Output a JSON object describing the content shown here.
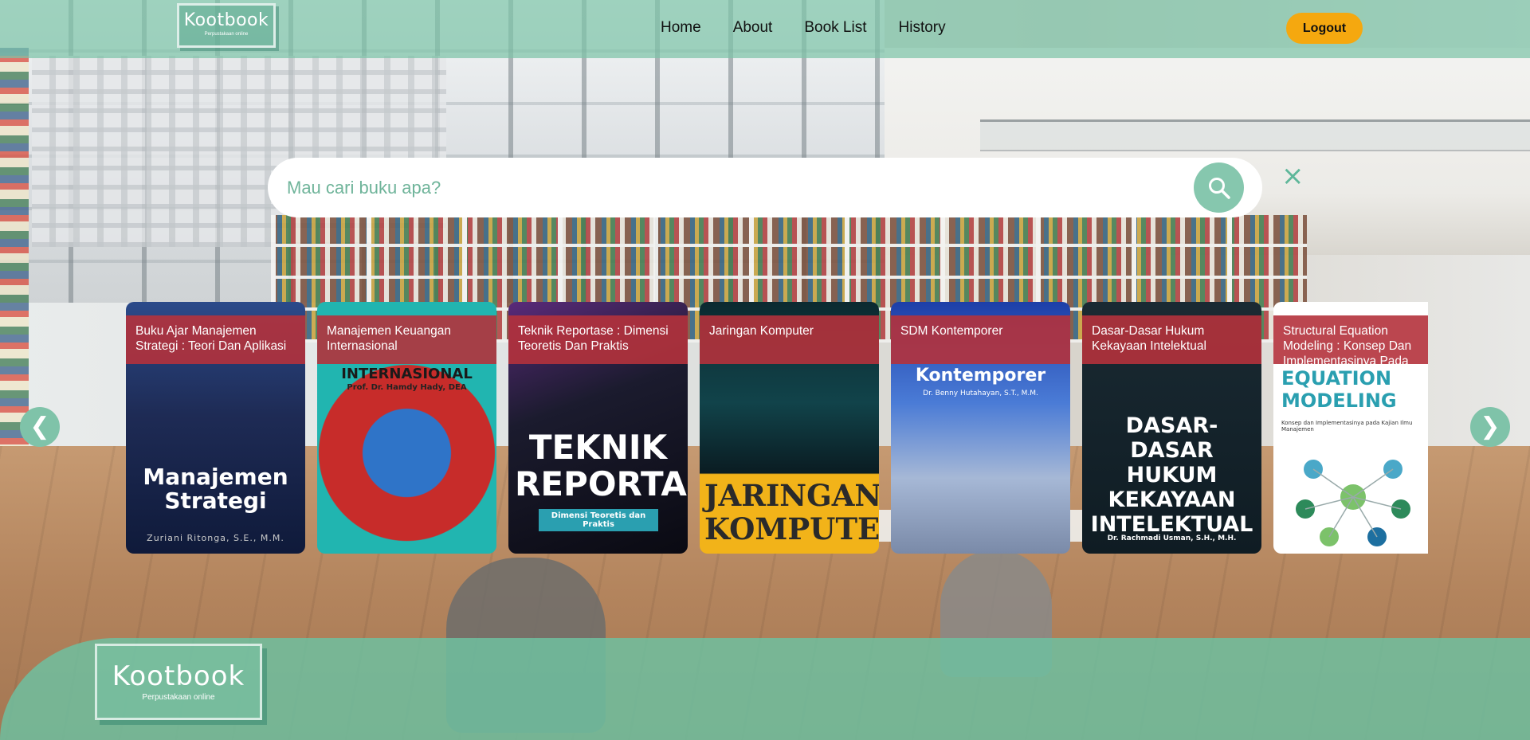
{
  "nav": {
    "logo_text": "Kootbook",
    "logo_sub": "Perpustakaan online",
    "links": [
      "Home",
      "About",
      "Book List",
      "History"
    ],
    "logout_label": "Logout"
  },
  "search": {
    "placeholder": "Mau cari buku apa?",
    "clear_icon": "×"
  },
  "carousel": {
    "prev_icon": "❮",
    "next_icon": "❯",
    "books": [
      {
        "title": "Buku Ajar Manajemen Strategi : Teori Dan Aplikasi",
        "cover_text": "Manajemen Strategi",
        "cover_sub": "Zuriani Ritonga, S.E., M.M."
      },
      {
        "title": "Manajemen Keuangan Internasional",
        "cover_text": "INTERNASIONAL",
        "cover_sub": "Prof. Dr. Hamdy Hady, DEA"
      },
      {
        "title": "Teknik Reportase : Dimensi Teoretis Dan Praktis",
        "cover_text": "TEKNIK REPORTASE",
        "cover_sub": "Dimensi Teoretis dan Praktis"
      },
      {
        "title": "Jaringan Komputer",
        "cover_text": "JARINGAN KOMPUTER",
        "cover_sub": ""
      },
      {
        "title": "SDM Kontemporer",
        "cover_text": "Kontemporer",
        "cover_sub": "Dr. Benny Hutahayan, S.T., M.M."
      },
      {
        "title": "Dasar-Dasar Hukum Kekayaan Intelektual",
        "cover_text": "DASAR-DASAR HUKUM KEKAYAAN INTELEKTUAL",
        "cover_sub": "Dr. Rachmadi Usman, S.H., M.H."
      },
      {
        "title": "Structural Equation Modeling : Konsep Dan Implementasinya Pada ...",
        "cover_text": "EQUATION MODELING",
        "cover_sub": "Konsep dan Implementasinya pada Kajian Ilmu Manajemen"
      }
    ]
  },
  "footer": {
    "logo_text": "Kootbook",
    "logo_sub": "Perpustakaan online"
  },
  "colors": {
    "nav_bg": "#7dc4a7",
    "accent": "#86c7ae",
    "logout": "#f5a80f",
    "card_title_bg": "#b4323c"
  }
}
